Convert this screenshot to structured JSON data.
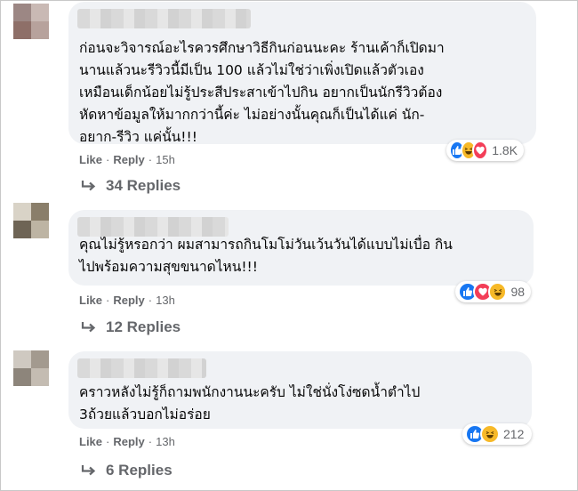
{
  "comments": [
    {
      "text": "ก่อนจะวิจารณ์อะไรควรศึกษาวิธีกินก่อนนะคะ ร้านเค้าก็เปิดมา\nนานแล้วนะรีวิวนี้มีเป็น 100 แล้วไม่ใช่ว่าเพิ่งเปิดแล้วตัวเอง\nเหมือนเด็กน้อยไม่รู้ประสีประสาเข้าไปกิน อยากเป็นนักรีวิวต้อง\nหัดหาข้อมูลให้มากกว่านี้ค่ะ ไม่อย่างนั้นคุณก็เป็นได้แค่ นัก-\nอยาก-รีวิว แค่นั้น!!!",
      "reactions": [
        "like-icon",
        "haha-icon",
        "love-icon"
      ],
      "reaction_count": "1.8K",
      "like_label": "Like",
      "reply_label": "Reply",
      "time": "15h",
      "replies_label": "34 Replies"
    },
    {
      "text": "คุณไม่รู้หรอกว่า ผมสามารถกินโมโม่วันเว้นวันได้แบบไม่เบื่อ กิน\nไปพร้อมความสุขขนาดไหน!!!",
      "reactions": [
        "like-icon",
        "love-icon",
        "haha-icon"
      ],
      "reaction_count": "98",
      "like_label": "Like",
      "reply_label": "Reply",
      "time": "13h",
      "replies_label": "12 Replies"
    },
    {
      "text": "คราวหลังไม่รู้ก็ถามพนักงานนะครับ ไม่ใช่นั่งโง่ซดน้ำตำไป\n3ถ้วยแล้วบอกไม่อร่อย",
      "reactions": [
        "like-icon",
        "haha-icon"
      ],
      "reaction_count": "212",
      "like_label": "Like",
      "reply_label": "Reply",
      "time": "13h",
      "replies_label": "6 Replies"
    }
  ],
  "colors": {
    "bubble": "#f0f2f5",
    "meta_text": "#65676b",
    "like_blue": "#1877f2",
    "love_red": "#f33e58",
    "haha_yellow": "#f7b928"
  }
}
